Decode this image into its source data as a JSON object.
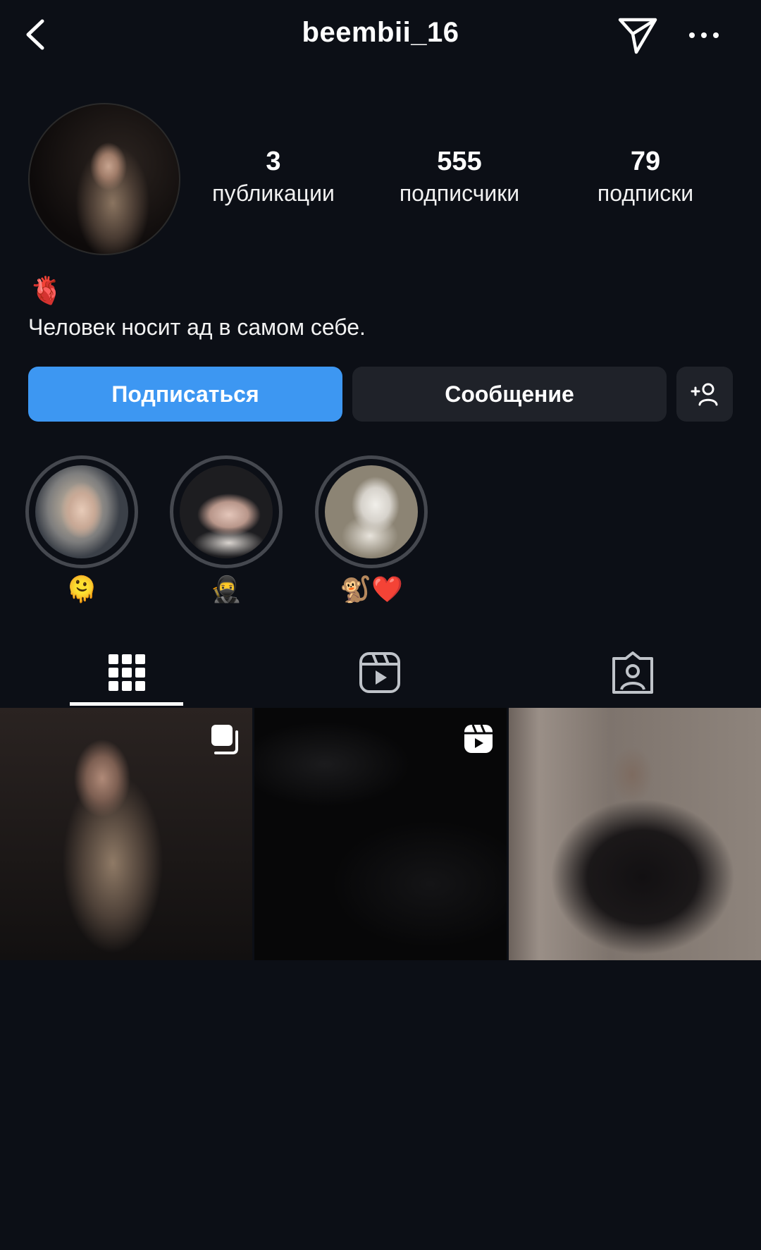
{
  "header": {
    "username": "beembii_16"
  },
  "stats": [
    {
      "value": "3",
      "label": "публикации"
    },
    {
      "value": "555",
      "label": "подписчики"
    },
    {
      "value": "79",
      "label": "подписки"
    }
  ],
  "bio": {
    "emoji": "🫀",
    "text": "Человек носит ад в самом себе."
  },
  "actions": {
    "follow_label": "Подписаться",
    "message_label": "Сообщение"
  },
  "highlights": [
    {
      "caption": "🫠"
    },
    {
      "caption": "🥷"
    },
    {
      "caption": "🐒❤️"
    }
  ],
  "tabs": [
    "grid-icon",
    "reels-icon",
    "tagged-icon"
  ],
  "colors": {
    "background": "#0c0f16",
    "follow_button": "#3d97f2",
    "secondary_button": "#1f2229"
  }
}
